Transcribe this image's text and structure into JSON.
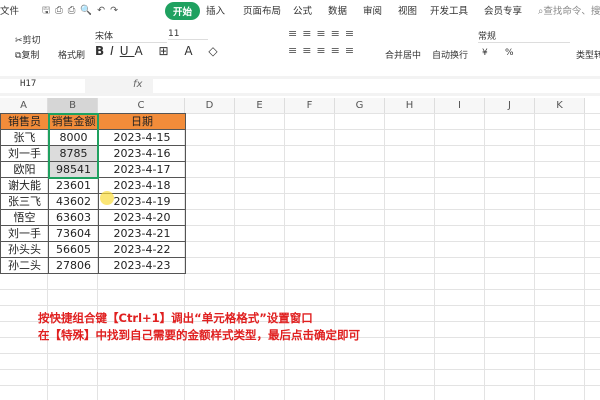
{
  "menu": {
    "file": "文件",
    "tabs": [
      "开始",
      "插入",
      "页面布局",
      "公式",
      "数据",
      "审阅",
      "视图",
      "开发工具",
      "会员专享"
    ],
    "search_placeholder": "查找命令、搜索"
  },
  "toolbar": {
    "cut": "剪切",
    "copy": "复制",
    "format_painter": "格式刷",
    "font": "宋体",
    "font_size": "11",
    "merge": "合并居中",
    "wrap": "自动换行",
    "number_format": "常规",
    "currency": "¥",
    "percent": "%",
    "convert": "类型转"
  },
  "formula_bar": {
    "cell_ref": "H17",
    "fx": "fx",
    "value": ""
  },
  "columns": [
    "A",
    "B",
    "C",
    "D",
    "E",
    "F",
    "G",
    "H",
    "I",
    "J",
    "K"
  ],
  "table": {
    "headers": [
      "销售员",
      "销售金额",
      "日期"
    ],
    "rows": [
      [
        "张飞",
        "8000",
        "2023-4-15"
      ],
      [
        "刘一手",
        "8785",
        "2023-4-16"
      ],
      [
        "欧阳",
        "98541",
        "2023-4-17"
      ],
      [
        "谢大能",
        "23601",
        "2023-4-18"
      ],
      [
        "张三飞",
        "43602",
        "2023-4-19"
      ],
      [
        "悟空",
        "63603",
        "2023-4-20"
      ],
      [
        "刘一手",
        "73604",
        "2023-4-21"
      ],
      [
        "孙头头",
        "56605",
        "2023-4-22"
      ],
      [
        "孙二头",
        "27806",
        "2023-4-23"
      ]
    ]
  },
  "instructions": [
    "按快捷组合键【Ctrl+1】调出“单元格格式”设置窗口",
    "在【特殊】中找到自己需要的金额样式类型，最后点击确定即可"
  ],
  "colors": {
    "accent": "#1fa160",
    "header_fill": "#f28c3a",
    "selection": "#1fa160",
    "instruction": "#e02020"
  }
}
